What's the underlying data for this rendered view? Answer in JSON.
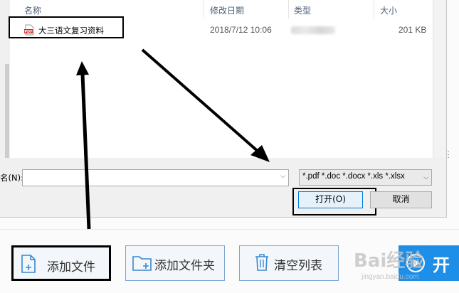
{
  "file_list": {
    "columns": {
      "name": "名称",
      "modified": "修改日期",
      "type": "类型",
      "size": "大小"
    },
    "rows": [
      {
        "name": "大三语文复习资料",
        "modified": "2018/7/12 10:06",
        "size": "201 KB",
        "icon": "pdf-file-icon",
        "icon_text": "PDF"
      }
    ]
  },
  "filename": {
    "label": "名(N):",
    "value": ""
  },
  "file_type": {
    "selected": "*.pdf *.doc *.docx *.xls *.xlsx"
  },
  "buttons": {
    "open": "打开(O)",
    "cancel": "取消"
  },
  "toolbar": {
    "add_file": "添加文件",
    "add_folder": "添加文件夹",
    "clear_list": "清空列表",
    "start": "开"
  },
  "watermark": {
    "brand": "Bai经验",
    "url": "jingyan.baidu.com"
  },
  "colors": {
    "accent": "#1d8fe8",
    "highlight_border": "#000000",
    "button_border": "#7aa6d2"
  }
}
